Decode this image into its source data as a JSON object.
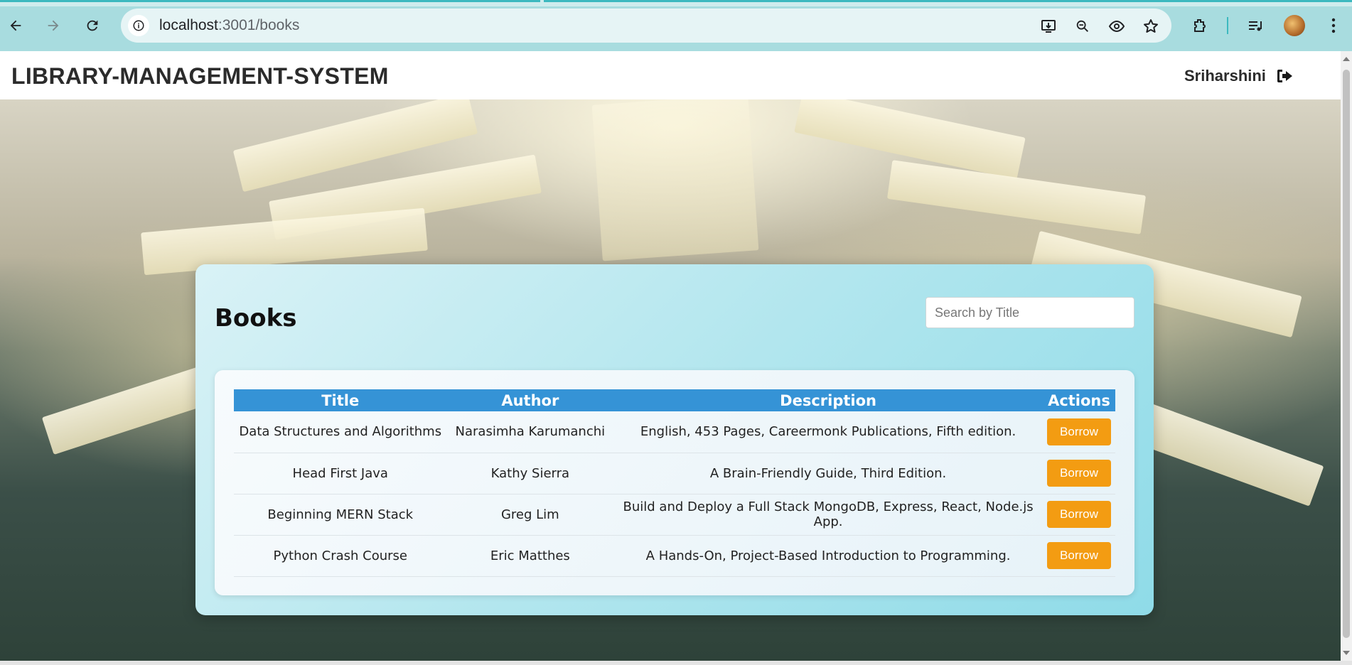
{
  "browser": {
    "url_host": "localhost",
    "url_path": ":3001/books",
    "icons": [
      "back-icon",
      "forward-icon",
      "reload-icon",
      "site-info-icon",
      "install-icon",
      "zoom-icon",
      "eye-icon",
      "bookmark-star-icon",
      "extensions-icon",
      "media-queue-icon",
      "profile-avatar",
      "menu-icon"
    ]
  },
  "header": {
    "title": "LIBRARY-MANAGEMENT-SYSTEM",
    "username": "Sriharshini"
  },
  "books_panel": {
    "heading": "Books",
    "search_placeholder": "Search by Title",
    "columns": [
      "Title",
      "Author",
      "Description",
      "Actions"
    ],
    "rows": [
      {
        "title": "Data Structures and Algorithms",
        "author": "Narasimha Karumanchi",
        "description": "English, 453 Pages, Careermonk Publications, Fifth edition.",
        "action": "Borrow"
      },
      {
        "title": "Head First Java",
        "author": "Kathy Sierra",
        "description": "A Brain-Friendly Guide, Third Edition.",
        "action": "Borrow"
      },
      {
        "title": "Beginning MERN Stack",
        "author": "Greg Lim",
        "description": "Build and Deploy a Full Stack MongoDB, Express, React, Node.js App.",
        "action": "Borrow"
      },
      {
        "title": "Python Crash Course",
        "author": "Eric Matthes",
        "description": "A Hands-On, Project-Based Introduction to Programming.",
        "action": "Borrow"
      }
    ]
  },
  "colors": {
    "header_row": "#3593d6",
    "borrow_button": "#f39c12",
    "chrome": "#a8dcdf"
  }
}
